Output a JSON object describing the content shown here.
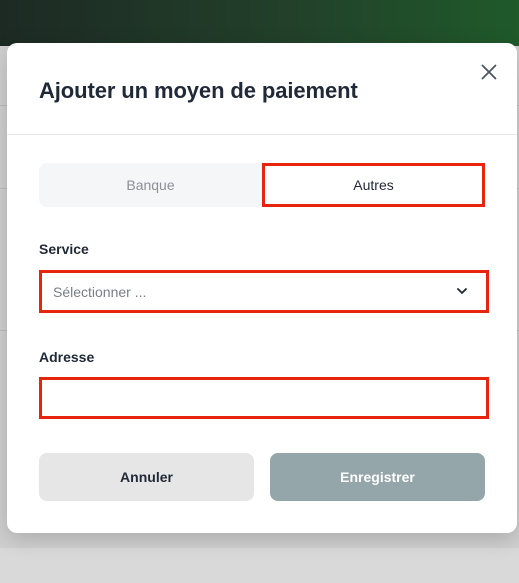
{
  "modal": {
    "title": "Ajouter un moyen de paiement",
    "close_icon": "close-icon"
  },
  "tabs": [
    {
      "label": "Banque",
      "active": false
    },
    {
      "label": "Autres",
      "active": true
    }
  ],
  "service": {
    "label": "Service",
    "selected": "Sélectionner ...",
    "icon": "chevron-down-icon"
  },
  "address": {
    "label": "Adresse",
    "value": "",
    "placeholder": ""
  },
  "actions": {
    "cancel_label": "Annuler",
    "save_label": "Enregistrer"
  },
  "colors": {
    "highlight": "#e8240c",
    "save_disabled": "#94a6a9",
    "cancel_bg": "#e6e6e6",
    "title_text": "#1f2937"
  }
}
